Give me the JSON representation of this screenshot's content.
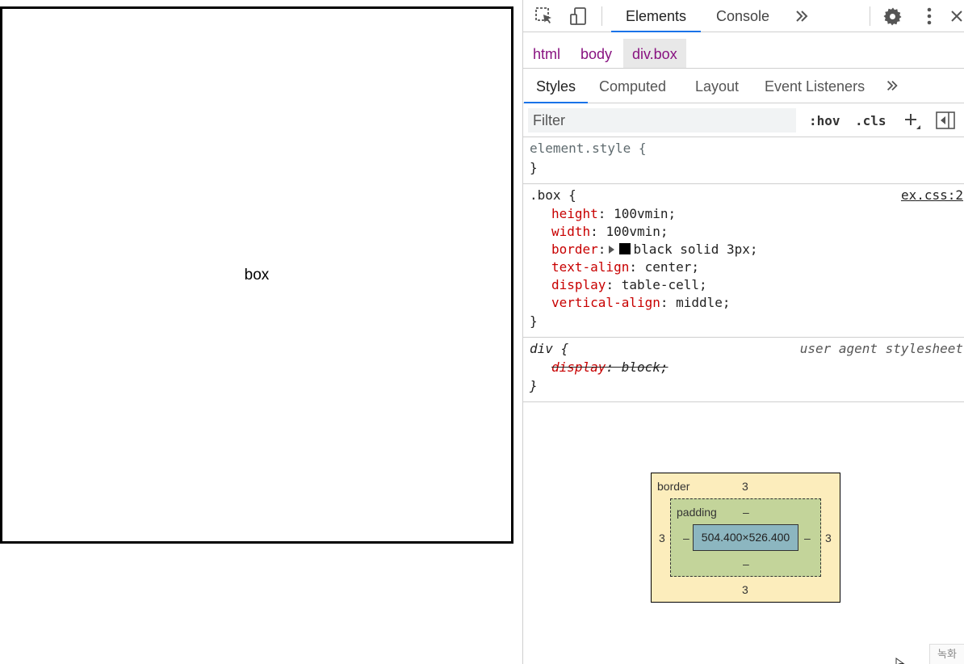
{
  "page": {
    "box_text": "box"
  },
  "devtools": {
    "tabs": [
      {
        "label": "Elements"
      },
      {
        "label": "Console"
      }
    ],
    "breadcrumbs": [
      {
        "label": "html"
      },
      {
        "label": "body"
      },
      {
        "label": "div.box"
      }
    ],
    "subtabs": [
      {
        "label": "Styles"
      },
      {
        "label": "Computed"
      },
      {
        "label": "Layout"
      },
      {
        "label": "Event Listeners"
      }
    ],
    "filter": {
      "placeholder": "Filter"
    },
    "filter_buttons": {
      "hov": ":hov",
      "cls": ".cls"
    },
    "rules": {
      "element_style": {
        "selector": "element.style {",
        "close": "}"
      },
      "box": {
        "selector": ".box {",
        "source": "ex.css:2",
        "decls": [
          {
            "prop": "height",
            "value": "100vmin;"
          },
          {
            "prop": "width",
            "value": "100vmin;"
          },
          {
            "prop": "border",
            "value": "black solid 3px;"
          },
          {
            "prop": "text-align",
            "value": "center;"
          },
          {
            "prop": "display",
            "value": "table-cell;"
          },
          {
            "prop": "vertical-align",
            "value": "middle;"
          }
        ],
        "close": "}"
      },
      "div": {
        "selector": "div {",
        "source": "user agent stylesheet",
        "decls": [
          {
            "prop": "display",
            "value": "block;"
          }
        ],
        "close": "}"
      }
    },
    "box_model": {
      "border_label": "border",
      "border_top": "3",
      "border_bottom": "3",
      "border_left": "3",
      "border_right": "3",
      "padding_label": "padding",
      "padding_top": "–",
      "padding_bottom": "–",
      "padding_left": "–",
      "padding_right": "–",
      "content_size": "504.400×526.400"
    },
    "record_badge": "녹화"
  }
}
